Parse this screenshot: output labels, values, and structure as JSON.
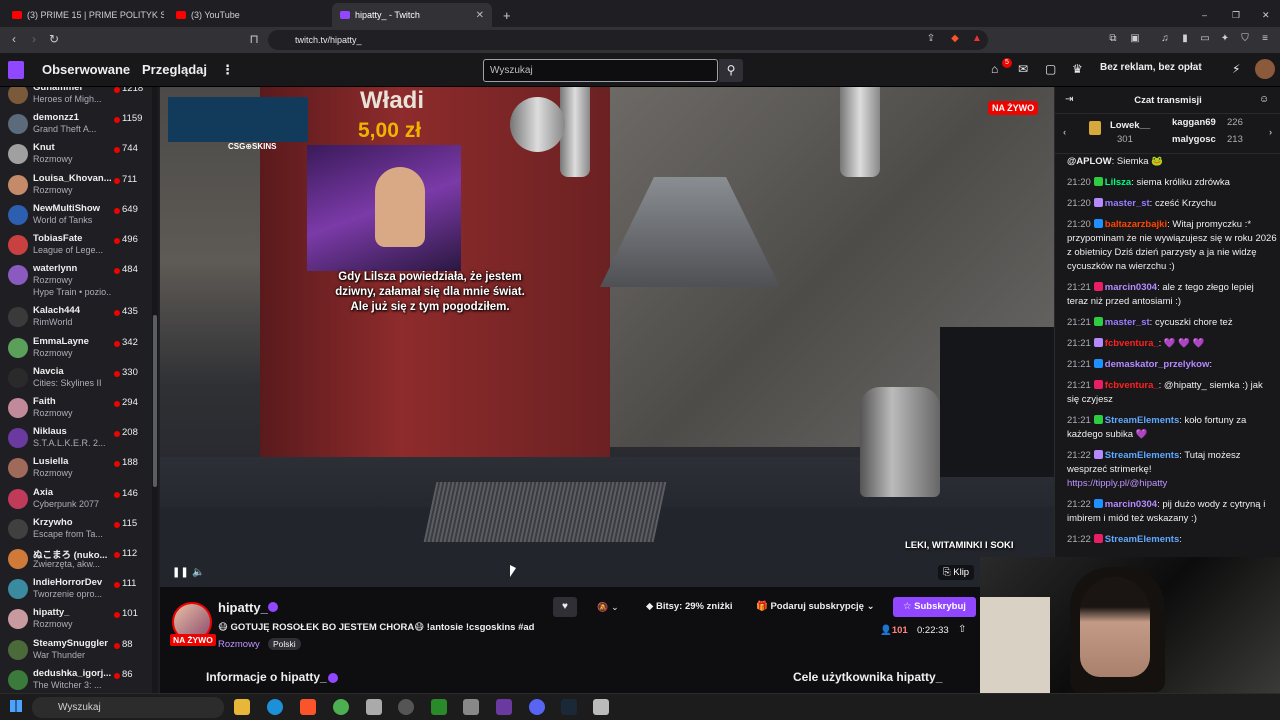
{
  "browser": {
    "tabs": [
      {
        "title": "(3) PRIME 15 | PRIME POLITYK SH",
        "active": false
      },
      {
        "title": "(3) YouTube",
        "active": false
      },
      {
        "title": "hipatty_ - Twitch",
        "active": true
      }
    ],
    "url": "twitch.tv/hipatty_"
  },
  "nav": {
    "following": "Obserwowane",
    "browse": "Przeglądaj",
    "search_placeholder": "Wyszukaj",
    "notif_count": "5",
    "no_ads": "Bez reklam, bez opłat"
  },
  "sidebar": {
    "channels": [
      {
        "name": "Gunammer",
        "category": "Heroes of Migh...",
        "viewers": "1218",
        "color": "#7a5a3a"
      },
      {
        "name": "demonzz1",
        "category": "Grand Theft A...",
        "viewers": "1159",
        "color": "#5b6b7b"
      },
      {
        "name": "Knut",
        "category": "Rozmowy",
        "viewers": "744",
        "color": "#a0a0a0"
      },
      {
        "name": "Louisa_Khovan...",
        "category": "Rozmowy",
        "viewers": "711",
        "color": "#c58a6a"
      },
      {
        "name": "NewMultiShow",
        "category": "World of Tanks",
        "viewers": "649",
        "color": "#2d5fb0"
      },
      {
        "name": "TobiasFate",
        "category": "League of Lege...",
        "viewers": "496",
        "color": "#c84040"
      },
      {
        "name": "waterlynn",
        "category": "Rozmowy",
        "extra": "Hype Train • pozio...",
        "viewers": "484",
        "color": "#8a5ac0"
      },
      {
        "name": "Kalach444",
        "category": "RimWorld",
        "viewers": "435",
        "color": "#3a3a3a"
      },
      {
        "name": "EmmaLayne",
        "category": "Rozmowy",
        "viewers": "342",
        "color": "#5aa05a"
      },
      {
        "name": "Navcia",
        "category": "Cities: Skylines II",
        "viewers": "330",
        "color": "#2a2a2a"
      },
      {
        "name": "Faith",
        "category": "Rozmowy",
        "viewers": "294",
        "color": "#c08a9a"
      },
      {
        "name": "Niklaus",
        "category": "S.T.A.L.K.E.R. 2...",
        "viewers": "208",
        "color": "#6a3aa0"
      },
      {
        "name": "Lusiella",
        "category": "Rozmowy",
        "viewers": "188",
        "color": "#a06a5a"
      },
      {
        "name": "Axia",
        "category": "Cyberpunk 2077",
        "viewers": "146",
        "color": "#c03a5a"
      },
      {
        "name": "Krzywho",
        "category": "Escape from Ta...",
        "viewers": "115",
        "color": "#404040"
      },
      {
        "name": "ぬこまろ (nuko...",
        "category": "Zwierzęta, akw...",
        "viewers": "112",
        "color": "#d07a3a"
      },
      {
        "name": "IndieHorrorDev",
        "category": "Tworzenie opro...",
        "viewers": "111",
        "color": "#3a8aa0"
      },
      {
        "name": "hipatty_",
        "category": "Rozmowy",
        "viewers": "101",
        "color": "#c89aa0"
      },
      {
        "name": "SteamySnuggler",
        "category": "War Thunder",
        "viewers": "88",
        "color": "#4a6a3a"
      },
      {
        "name": "dedushka_igorj...",
        "category": "The Witcher 3: ...",
        "viewers": "86",
        "color": "#3a7a3a"
      }
    ]
  },
  "video": {
    "donor": "Władi",
    "amount": "5,00 zł",
    "brand": "CSG⊕SKINS",
    "caption_lines": [
      "Gdy Lilsza powiedziała, że jestem",
      "dziwny, załamał się dla mnie świat.",
      "Ale już się z tym pogodziłem."
    ],
    "live": "NA ŻYWO",
    "corner_text": "LEKI, WITAMINKI I SOKI",
    "clip": "Klip"
  },
  "channel": {
    "name": "hipatty_",
    "live": "NA ŻYWO",
    "title": "😷 GOTUJĘ ROSOŁEK BO JESTEM CHORA😷 !antosie !csgoskins #ad",
    "category": "Rozmowy",
    "language": "Polski",
    "bits": "Bitsy: 29% zniżki",
    "gift": "Podaruj subskrypcję",
    "subscribe": "Subskrybuj",
    "viewers": "101",
    "uptime": "0:22:33",
    "about": "Informacje o hipatty_",
    "goals": "Cele użytkownika hipatty_"
  },
  "chat": {
    "title": "Czat transmisji",
    "leaderboard": [
      {
        "name": "Lowek__",
        "count": "301"
      },
      {
        "name": "kaggan69",
        "count": "226"
      },
      {
        "name": "malygosc",
        "count": "213"
      }
    ],
    "messages": [
      {
        "time": "",
        "user": "@APLOW",
        "color": "#efeff1",
        "text": "Siemka 🐸"
      },
      {
        "time": "21:20",
        "user": "Lilsza",
        "color": "#00ff7f",
        "text": "siema króliku zdrówka"
      },
      {
        "time": "21:20",
        "user": "master_st",
        "color": "#9a7cff",
        "text": "cześć Krzychu"
      },
      {
        "time": "21:20",
        "user": "baltazarzbajki",
        "color": "#ff4500",
        "text": "Witaj promyczku :* przypominam że nie wywiązujesz się w roku 2026 z obietnicy Dziś dzień parzysty a ja nie widzę cycuszków na wierzchu :)"
      },
      {
        "time": "21:21",
        "user": "marcin0304",
        "color": "#b58aff",
        "text": "ale z tego złego lepiej teraz niż przed antosiami :)"
      },
      {
        "time": "21:21",
        "user": "master_st",
        "color": "#9a7cff",
        "text": "cycuszki chore też"
      },
      {
        "time": "21:21",
        "user": "fcbventura_",
        "color": "#ff2020",
        "text": "💜 💜 💜"
      },
      {
        "time": "21:21",
        "user": "demaskator_przelykow",
        "color": "#b58aff",
        "text": ""
      },
      {
        "time": "21:21",
        "user": "fcbventura_",
        "color": "#ff2020",
        "text": "@hipatty_ siemka :) jak się czyjesz"
      },
      {
        "time": "21:21",
        "user": "StreamElements",
        "color": "#5fa8ff",
        "text": "koło fortuny za każdego subika 💜"
      },
      {
        "time": "21:22",
        "user": "StreamElements",
        "color": "#5fa8ff",
        "text": "Tutaj możesz wesprzeć strimerkę!",
        "link": "https://tipply.pl/@hipatty"
      },
      {
        "time": "21:22",
        "user": "marcin0304",
        "color": "#b58aff",
        "text": "pij dużo wody z cytryną i imbirem i miód też wskazany :)"
      },
      {
        "time": "21:22",
        "user": "StreamElements",
        "color": "#5fa8ff",
        "text": ""
      }
    ]
  },
  "taskbar": {
    "search": "Wyszukaj"
  }
}
